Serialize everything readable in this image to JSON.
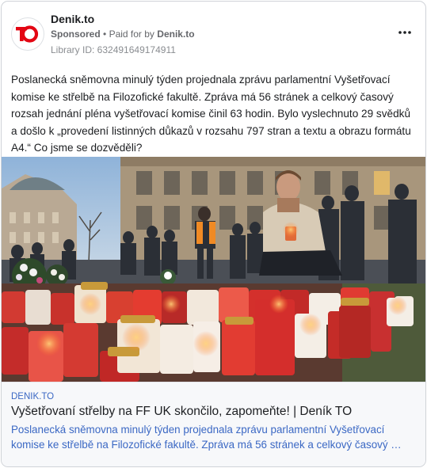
{
  "advertiser": {
    "name": "Denik.to",
    "sponsored_label": "Sponsored",
    "separator": "•",
    "paid_for_prefix": "Paid for by",
    "paid_for_name": "Denik.to",
    "library_id": "Library ID: 632491649174911",
    "logo_text": "TO"
  },
  "post": {
    "text": "Poslanecká sněmovna minulý týden projednala zprávu parlamentní Vyšetřovací komise ke střelbě na Filozofické fakultě. Zpráva má 56 stránek a celkový časový rozsah jednání pléna vyšetřovací komise činil 63 hodin. Bylo vyslechnuto 29 svědků a došlo k „provedení listinných důkazů v rozsahu 797 stran a textu a obrazu formátu A4.“ Co jsme se dozvěděli?"
  },
  "link": {
    "domain": "DENIK.TO",
    "title": "Vyšetřovaní střelby na FF UK skončilo, zapomeňte! | Deník TO",
    "description": "Poslanecká sněmovna minulý týden projednala zprávu parlamentní Vyšetřovací komise ke střelbě na Filozofické fakultě. Zpráva má 56 stránek a celkový časový …"
  },
  "icons": {
    "more": "more-horizontal-icon",
    "logo": "denik-to-logo"
  },
  "colors": {
    "brand_red": "#e30613",
    "link_blue": "#3b68c4",
    "meta_gray": "#65676b"
  }
}
